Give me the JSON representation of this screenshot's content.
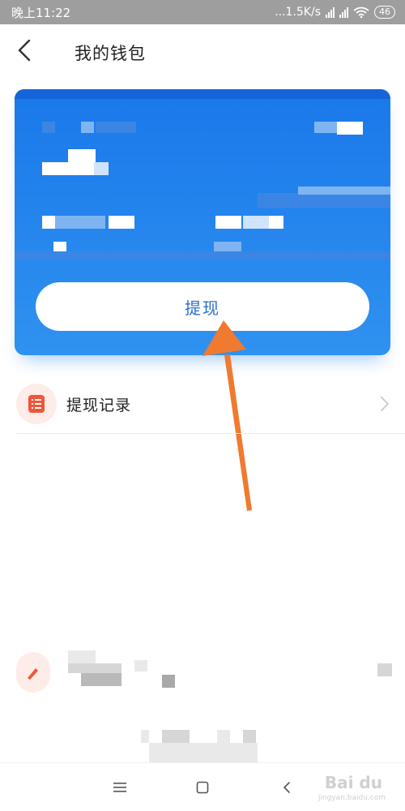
{
  "status_bar": {
    "time": "晚上11:22",
    "network_speed": "...1.5K/s",
    "battery": "46"
  },
  "header": {
    "title": "我的钱包"
  },
  "wallet_card": {
    "withdraw_label": "提现"
  },
  "list": {
    "withdraw_record_label": "提现记录"
  },
  "watermark": {
    "brand": "Bai du",
    "site": "jingyan.baidu.com"
  },
  "colors": {
    "card_blue": "#1a78ea",
    "button_text": "#2a6fc9",
    "arrow": "#f07a2f",
    "icon_red": "#f0553a"
  },
  "icons": {
    "back": "chevron-left-icon",
    "record": "document-list-icon",
    "chevron": "chevron-right-icon",
    "nav_menu": "menu-icon",
    "nav_home": "home-square-icon",
    "nav_back": "back-triangle-icon"
  }
}
